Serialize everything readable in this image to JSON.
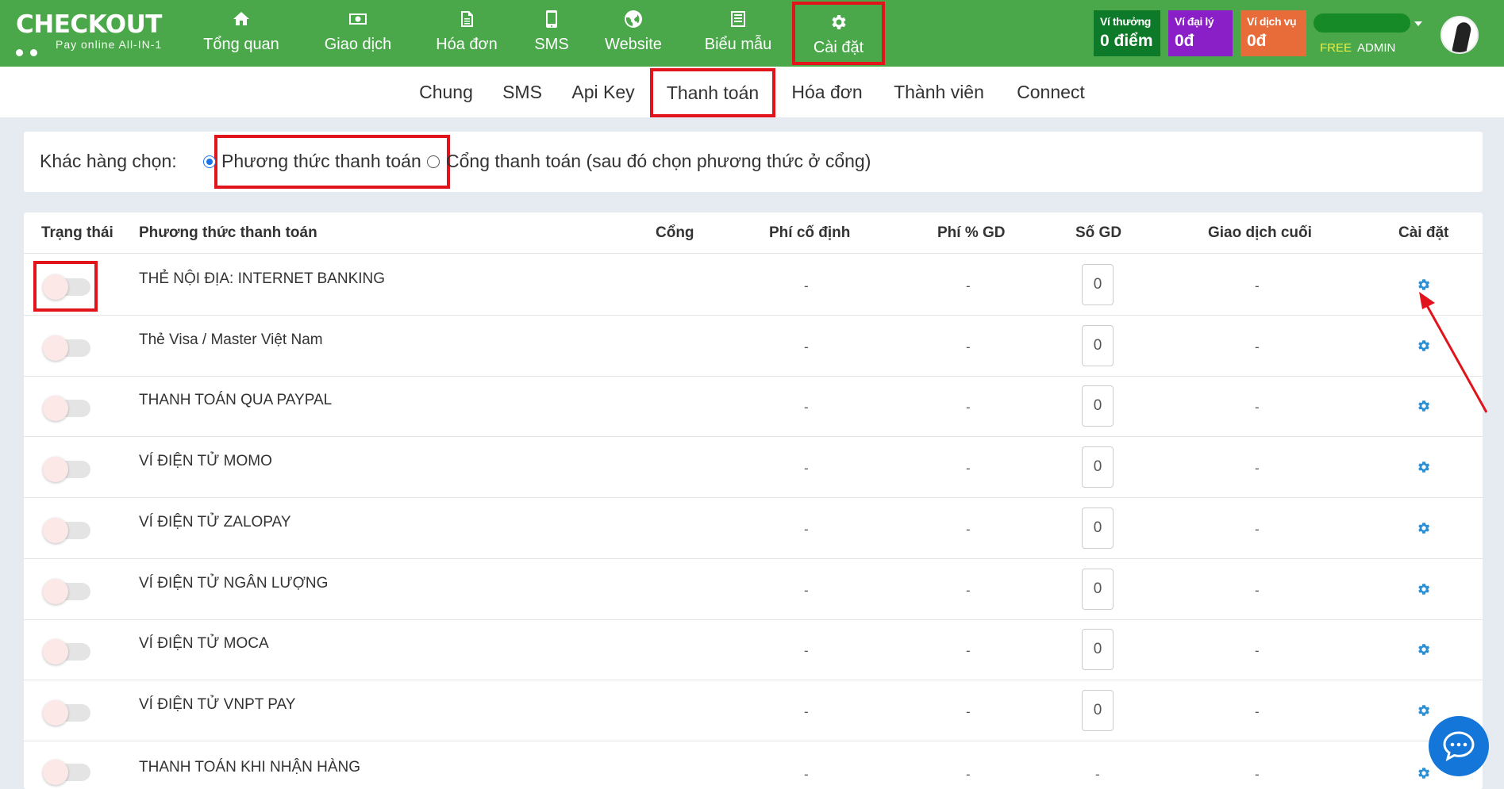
{
  "brand": {
    "name": "CHECKOUT",
    "tagline": "Pay online All-IN-1"
  },
  "top_nav": [
    {
      "label": "Tổng quan",
      "icon": "home-icon"
    },
    {
      "label": "Giao dịch",
      "icon": "money-icon"
    },
    {
      "label": "Hóa đơn",
      "icon": "invoice-icon"
    },
    {
      "label": "SMS",
      "icon": "phone-icon"
    },
    {
      "label": "Website",
      "icon": "globe-icon"
    },
    {
      "label": "Biểu mẫu",
      "icon": "form-icon"
    },
    {
      "label": "Cài đặt",
      "icon": "gear-icon",
      "active": true
    }
  ],
  "wallets": [
    {
      "label": "Ví thưởng",
      "value": "0 điểm",
      "color": "#0d7a2a"
    },
    {
      "label": "Ví đại lý",
      "value": "0đ",
      "color": "#8b1fc7"
    },
    {
      "label": "Ví dịch vụ",
      "value": "0đ",
      "color": "#e86b3a"
    }
  ],
  "user": {
    "plan": "FREE",
    "role": "ADMIN"
  },
  "sub_nav": [
    "Chung",
    "SMS",
    "Api Key",
    "Thanh toán",
    "Hóa đơn",
    "Thành viên",
    "Connect"
  ],
  "sub_nav_active": "Thanh toán",
  "choice": {
    "label": "Khác hàng chọn:",
    "options": [
      {
        "label": "Phương thức thanh toán",
        "selected": true
      },
      {
        "label": "Cổng thanh toán (sau đó chọn phương thức ở cổng)",
        "selected": false
      }
    ]
  },
  "table": {
    "columns": [
      "Trạng thái",
      "Phương thức thanh toán",
      "Cổng",
      "Phí cố định",
      "Phí % GD",
      "Số GD",
      "Giao dịch cuối",
      "Cài đặt"
    ],
    "rows": [
      {
        "name": "THẺ NỘI ĐỊA: INTERNET BANKING",
        "fixed_fee": "-",
        "pct_fee": "-",
        "count": "0",
        "last": "-"
      },
      {
        "name": "Thẻ Visa / Master Việt Nam",
        "fixed_fee": "-",
        "pct_fee": "-",
        "count": "0",
        "last": "-"
      },
      {
        "name": "THANH TOÁN QUA PAYPAL",
        "fixed_fee": "-",
        "pct_fee": "-",
        "count": "0",
        "last": "-"
      },
      {
        "name": "VÍ ĐIỆN TỬ MOMO",
        "fixed_fee": "-",
        "pct_fee": "-",
        "count": "0",
        "last": "-"
      },
      {
        "name": "VÍ ĐIỆN TỬ ZALOPAY",
        "fixed_fee": "-",
        "pct_fee": "-",
        "count": "0",
        "last": "-"
      },
      {
        "name": "VÍ ĐIỆN TỬ NGÂN LƯỢNG",
        "fixed_fee": "-",
        "pct_fee": "-",
        "count": "0",
        "last": "-"
      },
      {
        "name": "VÍ ĐIỆN TỬ MOCA",
        "fixed_fee": "-",
        "pct_fee": "-",
        "count": "0",
        "last": "-"
      },
      {
        "name": "VÍ ĐIỆN TỬ VNPT PAY",
        "fixed_fee": "-",
        "pct_fee": "-",
        "count": "0",
        "last": "-"
      },
      {
        "name": "THANH TOÁN KHI NHẬN HÀNG",
        "fixed_fee": "-",
        "pct_fee": "-",
        "count": "-",
        "last": "-"
      }
    ]
  },
  "colors": {
    "topbar": "#4aa84a",
    "highlight": "#e1141b",
    "gear": "#2b8fd4",
    "chat": "#1476d9"
  }
}
